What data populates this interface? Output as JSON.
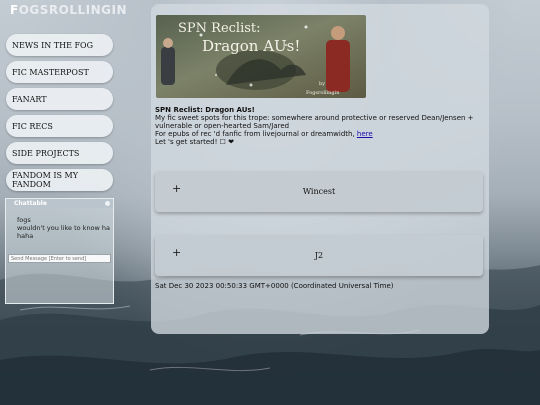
{
  "site": {
    "title_first": "F",
    "title_rest": "OGSROLLINGIN"
  },
  "nav": [
    {
      "label": "NEWS IN THE FOG"
    },
    {
      "label": "FIC MASTERPOST"
    },
    {
      "label": "FANART"
    },
    {
      "label": "FIC RECS"
    },
    {
      "label": "SIDE PROJECTS"
    },
    {
      "label": "FANDOM IS MY FANDOM"
    }
  ],
  "chat": {
    "title": "Chattable",
    "messages": [
      "fogs",
      "wouldn't you like to know ha",
      "haha"
    ],
    "input_placeholder": "Send Message [Enter to send]"
  },
  "banner": {
    "line1": "SPN Reclist:",
    "line2": "Dragon AUs!",
    "credit1": "by",
    "credit2": "Fogsrollingin"
  },
  "post": {
    "title": "SPN Reclist: Dragon AUs!",
    "line1": "My fic sweet spots for this trope: somewhere around protective or reserved Dean/Jensen +",
    "line2": "vulnerable or open-hearted Sam/Jared",
    "line3_prefix": "For epubs of rec 'd fanfic from livejournal or dreamwidth, ",
    "link_text": "here",
    "line4": "Let 's get started! ☐ ❤"
  },
  "accordions": [
    {
      "plus": "+",
      "label": "Wincest"
    },
    {
      "plus": "+",
      "label": "J2"
    }
  ],
  "timestamp": "Sat Dec 30 2023 00:50:33 GMT+0000 (Coordinated Universal Time)",
  "colors": {
    "panel": "#d2dae0",
    "link": "#1a0dab",
    "sea_dark": "#2f3d46"
  }
}
